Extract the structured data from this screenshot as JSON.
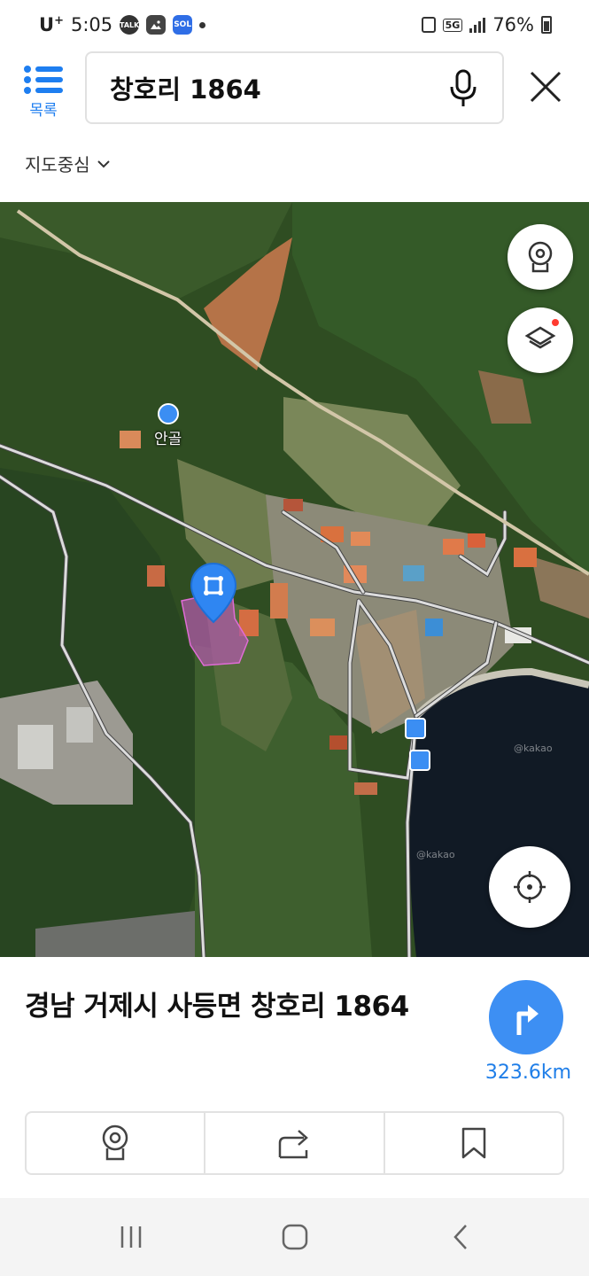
{
  "status_bar": {
    "carrier": "U",
    "carrier_sup": "+",
    "time": "5:05",
    "talk_icon_text": "TALK",
    "sol_icon_text": "SOL",
    "network": "5G",
    "battery": "76%"
  },
  "header": {
    "list_label": "목록",
    "search_value": "창호리 1864",
    "map_center_label": "지도중심"
  },
  "map": {
    "poi_name": "안골",
    "watermark": "@kakao"
  },
  "place": {
    "address": "경남 거제시 사등면 창호리 1864",
    "distance": "323.6km"
  },
  "colors": {
    "accent": "#1e7ef0",
    "route_button": "#3d8ff3",
    "pin": "#2f86f2",
    "parcel": "#b05aa8"
  }
}
